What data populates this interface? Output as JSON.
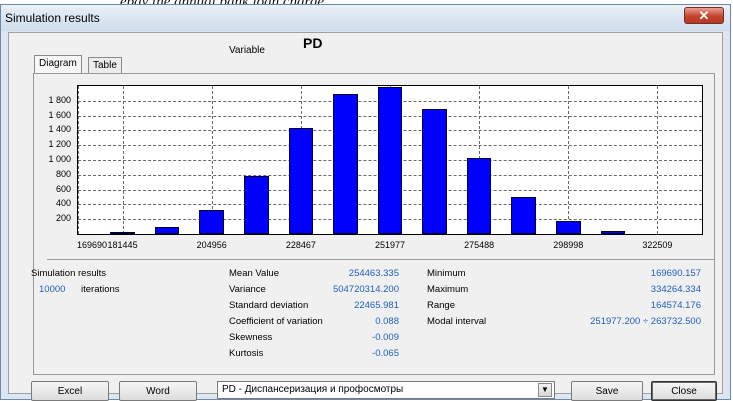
{
  "window": {
    "title": "Simulation results",
    "close_symbol": "✕"
  },
  "header": {
    "variable_label": "Variable",
    "variable_value": "PD"
  },
  "tabs": [
    {
      "label": "Diagram",
      "active": true
    },
    {
      "label": "Table",
      "active": false
    }
  ],
  "chart_data": {
    "type": "bar",
    "x_tick_labels": [
      "169690",
      "181445",
      "204956",
      "228467",
      "251977",
      "275488",
      "298998",
      "322509"
    ],
    "y_tick_labels": [
      "200",
      "400",
      "600",
      "800",
      "1 000",
      "1 200",
      "1 400",
      "1 600",
      "1 800"
    ],
    "ylim": [
      0,
      2000
    ],
    "bins": [
      {
        "center": 181445,
        "value": 20
      },
      {
        "center": 193200,
        "value": 90
      },
      {
        "center": 204956,
        "value": 320
      },
      {
        "center": 216711,
        "value": 780
      },
      {
        "center": 228467,
        "value": 1430
      },
      {
        "center": 240222,
        "value": 1890
      },
      {
        "center": 251977,
        "value": 1990
      },
      {
        "center": 263733,
        "value": 1690
      },
      {
        "center": 275488,
        "value": 1030
      },
      {
        "center": 287243,
        "value": 500
      },
      {
        "center": 298998,
        "value": 175
      },
      {
        "center": 310754,
        "value": 40
      }
    ],
    "xlim": [
      169690,
      334264
    ],
    "grid": true,
    "bar_color": "#0000ff"
  },
  "stats": {
    "section_title": "Simulation results",
    "iterations_value": "10000",
    "iterations_label": "iterations",
    "mean_label": "Mean Value",
    "mean_value": "254463.335",
    "variance_label": "Variance",
    "variance_value": "504720314.200",
    "std_label": "Standard deviation",
    "std_value": "22465.981",
    "cv_label": "Coefficient of variation",
    "cv_value": "0.088",
    "skew_label": "Skewness",
    "skew_value": "-0.009",
    "kurt_label": "Kurtosis",
    "kurt_value": "-0.065",
    "min_label": "Minimum",
    "min_value": "169690.157",
    "max_label": "Maximum",
    "max_value": "334264.334",
    "range_label": "Range",
    "range_value": "164574.176",
    "modal_label": "Modal interval",
    "modal_value": "251977.200 ÷ 263732.500"
  },
  "footer": {
    "excel_label": "Excel",
    "word_label": "Word",
    "dropdown_value": "PD - Диспансеризация и профосмотры",
    "save_label": "Save",
    "close_label": "Close"
  },
  "colors": {
    "accent_value": "#1f5fbf",
    "bar": "#0000ff"
  }
}
